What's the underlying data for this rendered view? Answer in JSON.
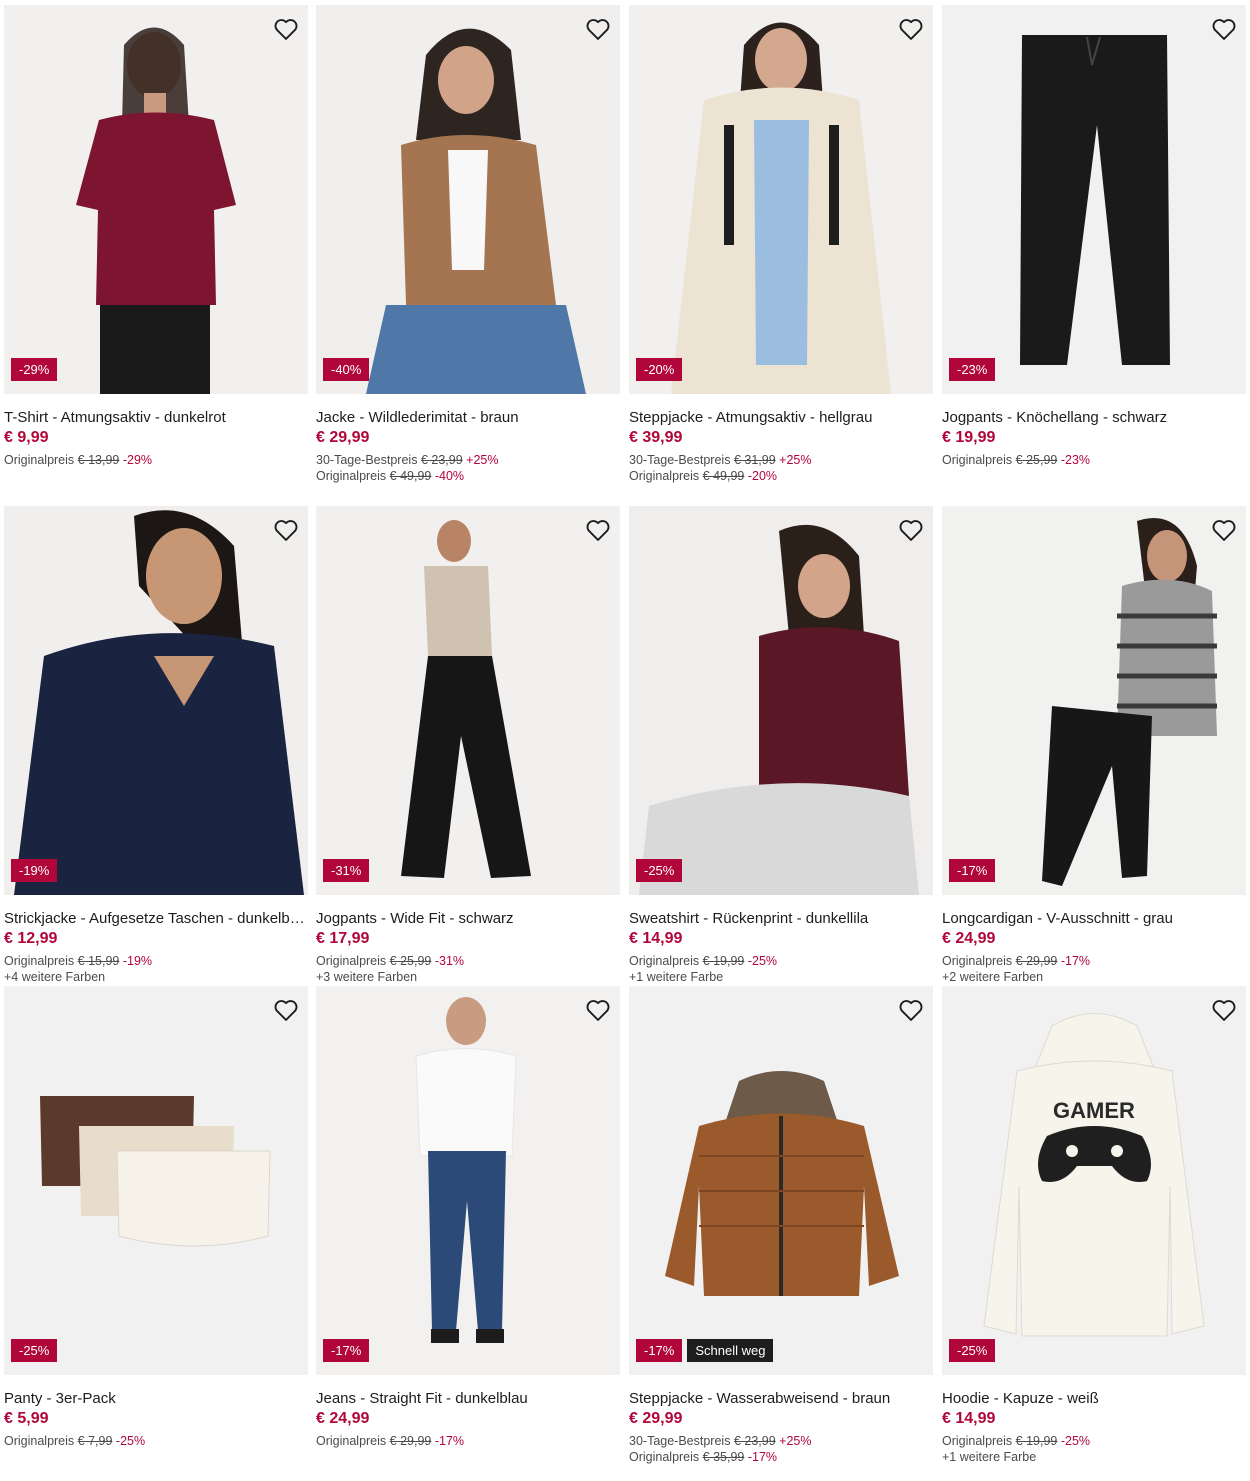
{
  "colors": {
    "accent": "#b1063a",
    "tag_dark": "#1e1e1e",
    "image_bg": "#f1f1f1"
  },
  "icons": {
    "favorite": "heart-outline-icon"
  },
  "products": [
    {
      "title": "T-Shirt - Atmungsaktiv - dunkelrot",
      "price": "€ 9,99",
      "discount": "-29%",
      "lines": [
        {
          "label": "Originalpreis",
          "old": "€ 13,99",
          "pct": "-29%"
        }
      ]
    },
    {
      "title": "Jacke - Wildlederimitat - braun",
      "price": "€ 29,99",
      "discount": "-40%",
      "lines": [
        {
          "label": "30-Tage-Bestpreis",
          "old": "€ 23,99",
          "pct": "+25%"
        },
        {
          "label": "Originalpreis",
          "old": "€ 49,99",
          "pct": "-40%"
        }
      ]
    },
    {
      "title": "Steppjacke - Atmungsaktiv - hellgrau",
      "price": "€ 39,99",
      "discount": "-20%",
      "lines": [
        {
          "label": "30-Tage-Bestpreis",
          "old": "€ 31,99",
          "pct": "+25%"
        },
        {
          "label": "Originalpreis",
          "old": "€ 49,99",
          "pct": "-20%"
        }
      ]
    },
    {
      "title": "Jogpants - Knöchellang - schwarz",
      "price": "€ 19,99",
      "discount": "-23%",
      "lines": [
        {
          "label": "Originalpreis",
          "old": "€ 25,99",
          "pct": "-23%"
        }
      ]
    },
    {
      "title": "Strickjacke - Aufgesetze Taschen - dunkelblau",
      "price": "€ 12,99",
      "discount": "-19%",
      "lines": [
        {
          "label": "Originalpreis",
          "old": "€ 15,99",
          "pct": "-19%"
        }
      ],
      "more_colors": "+4 weitere Farben"
    },
    {
      "title": "Jogpants - Wide Fit - schwarz",
      "price": "€ 17,99",
      "discount": "-31%",
      "lines": [
        {
          "label": "Originalpreis",
          "old": "€ 25,99",
          "pct": "-31%"
        }
      ],
      "more_colors": "+3 weitere Farben"
    },
    {
      "title": "Sweatshirt - Rückenprint - dunkellila",
      "price": "€ 14,99",
      "discount": "-25%",
      "lines": [
        {
          "label": "Originalpreis",
          "old": "€ 19,99",
          "pct": "-25%"
        }
      ],
      "more_colors": "+1 weitere Farbe"
    },
    {
      "title": "Longcardigan - V-Ausschnitt - grau",
      "price": "€ 24,99",
      "discount": "-17%",
      "lines": [
        {
          "label": "Originalpreis",
          "old": "€ 29,99",
          "pct": "-17%"
        }
      ],
      "more_colors": "+2 weitere Farben"
    },
    {
      "title": "Panty - 3er-Pack",
      "price": "€ 5,99",
      "discount": "-25%",
      "lines": [
        {
          "label": "Originalpreis",
          "old": "€ 7,99",
          "pct": "-25%"
        }
      ]
    },
    {
      "title": "Jeans - Straight Fit - dunkelblau",
      "price": "€ 24,99",
      "discount": "-17%",
      "lines": [
        {
          "label": "Originalpreis",
          "old": "€ 29,99",
          "pct": "-17%"
        }
      ]
    },
    {
      "title": "Steppjacke - Wasserabweisend - braun",
      "price": "€ 29,99",
      "discount": "-17%",
      "tag": "Schnell weg",
      "lines": [
        {
          "label": "30-Tage-Bestpreis",
          "old": "€ 23,99",
          "pct": "+25%"
        },
        {
          "label": "Originalpreis",
          "old": "€ 35,99",
          "pct": "-17%"
        }
      ]
    },
    {
      "title": "Hoodie - Kapuze - weiß",
      "price": "€ 14,99",
      "discount": "-25%",
      "print_text": "GAMER",
      "lines": [
        {
          "label": "Originalpreis",
          "old": "€ 19,99",
          "pct": "-25%"
        }
      ],
      "more_colors": "+1 weitere Farbe"
    }
  ]
}
